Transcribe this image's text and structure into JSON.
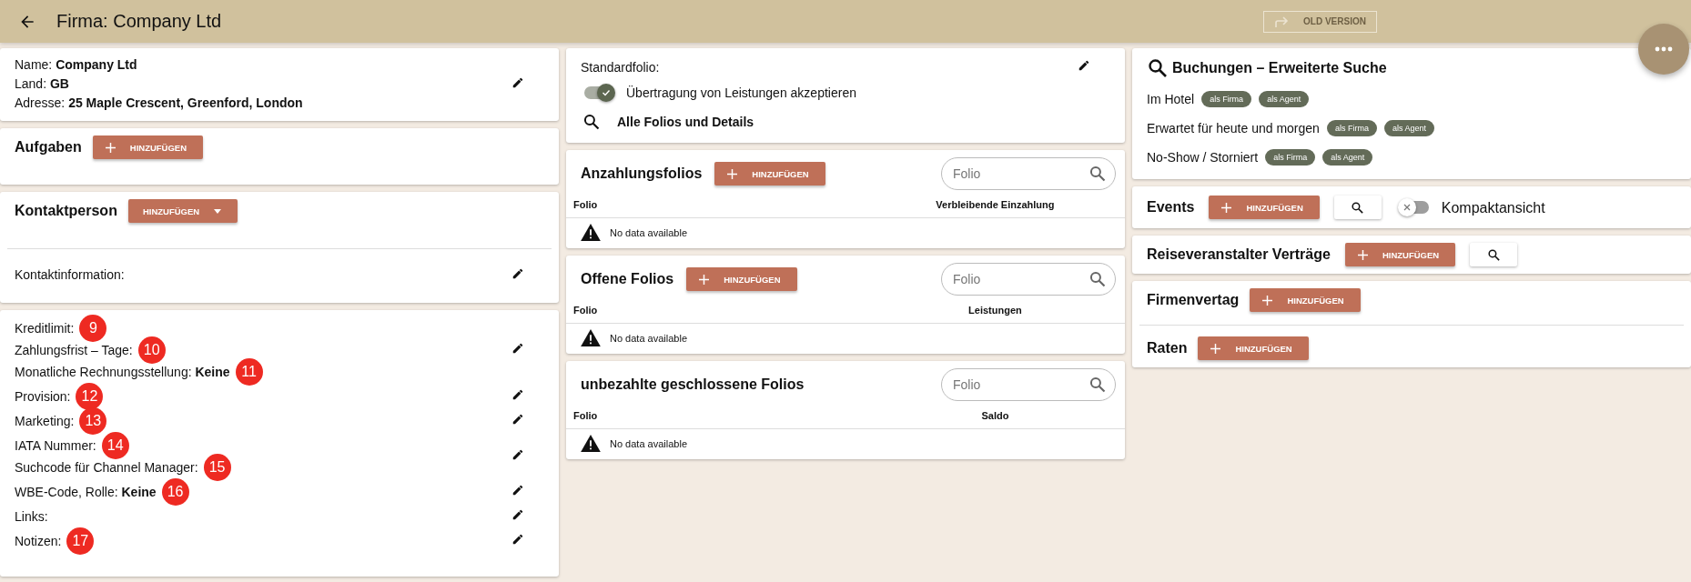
{
  "header": {
    "title": "Firma: Company Ltd",
    "old_version_button": "OLD VERSION"
  },
  "company": {
    "lines": [
      {
        "label": "Name:",
        "value": "Company Ltd"
      },
      {
        "label": "Land:",
        "value": "GB"
      },
      {
        "label": "Adresse:",
        "value": "25 Maple Crescent, Greenford, London"
      }
    ]
  },
  "tasks": {
    "title": "Aufgaben",
    "add_button": "HINZUFÜGEN"
  },
  "contact": {
    "title": "Kontaktperson",
    "add_button": "HINZUFÜGEN",
    "info_label": "Kontaktinformation:"
  },
  "details": {
    "groups": [
      {
        "lines": [
          {
            "label": "Kreditlimit:",
            "marker": "9"
          },
          {
            "label": "Zahlungsfrist – Tage:",
            "marker": "10"
          },
          {
            "label": "Monatliche Rechnungsstellung:",
            "value": "Keine",
            "marker": "11"
          }
        ]
      },
      {
        "lines": [
          {
            "label": "Provision:",
            "marker": "12"
          }
        ]
      },
      {
        "lines": [
          {
            "label": "Marketing:",
            "marker": "13"
          }
        ]
      },
      {
        "lines": [
          {
            "label": "IATA Nummer:",
            "marker": "14"
          },
          {
            "label": "Suchcode für Channel Manager:",
            "marker": "15"
          }
        ]
      },
      {
        "lines": [
          {
            "label": "WBE-Code, Rolle:",
            "value": "Keine",
            "marker": "16"
          }
        ]
      },
      {
        "lines": [
          {
            "label": "Links:"
          }
        ]
      },
      {
        "lines": [
          {
            "label": "Notizen:",
            "marker": "17"
          }
        ]
      }
    ]
  },
  "folio_settings": {
    "standard_label": "Standardfolio:",
    "transfer_toggle": {
      "label": "Übertragung von Leistungen akzeptieren",
      "on": true
    },
    "all_folios_link": "Alle Folios und Details"
  },
  "folio_tables": [
    {
      "title": "Anzahlungsfolios",
      "add_button": "HINZUFÜGEN",
      "search": {
        "placeholder": "Folio"
      },
      "columns": [
        "Folio",
        "Verbleibende Einzahlung"
      ],
      "empty_text": "No data available"
    },
    {
      "title": "Offene Folios",
      "add_button": "HINZUFÜGEN",
      "search": {
        "placeholder": "Folio"
      },
      "columns": [
        "Folio",
        "Leistungen"
      ],
      "empty_text": "No data available"
    },
    {
      "title": "unbezahlte geschlossene Folios",
      "search": {
        "placeholder": "Folio"
      },
      "columns": [
        "Folio",
        "Saldo"
      ],
      "empty_text": "No data available"
    }
  ],
  "bookings_search": {
    "title": "Buchungen – Erweiterte Suche",
    "rows": [
      {
        "label": "Im Hotel",
        "chips": [
          "als Firma",
          "als Agent"
        ]
      },
      {
        "label": "Erwartet für heute und morgen",
        "chips": [
          "als Firma",
          "als Agent"
        ]
      },
      {
        "label": "No-Show / Storniert",
        "chips": [
          "als Firma",
          "als Agent"
        ]
      }
    ]
  },
  "events": {
    "title": "Events",
    "add_button": "HINZUFÜGEN",
    "compact_toggle": {
      "label": "Kompaktansicht",
      "on": false
    }
  },
  "tour_contracts": {
    "title": "Reiseveranstalter Verträge",
    "add_button": "HINZUFÜGEN"
  },
  "company_contract": {
    "title": "Firmenvertag",
    "add_button": "HINZUFÜGEN"
  },
  "rates": {
    "title": "Raten",
    "add_button": "HINZUFÜGEN"
  }
}
